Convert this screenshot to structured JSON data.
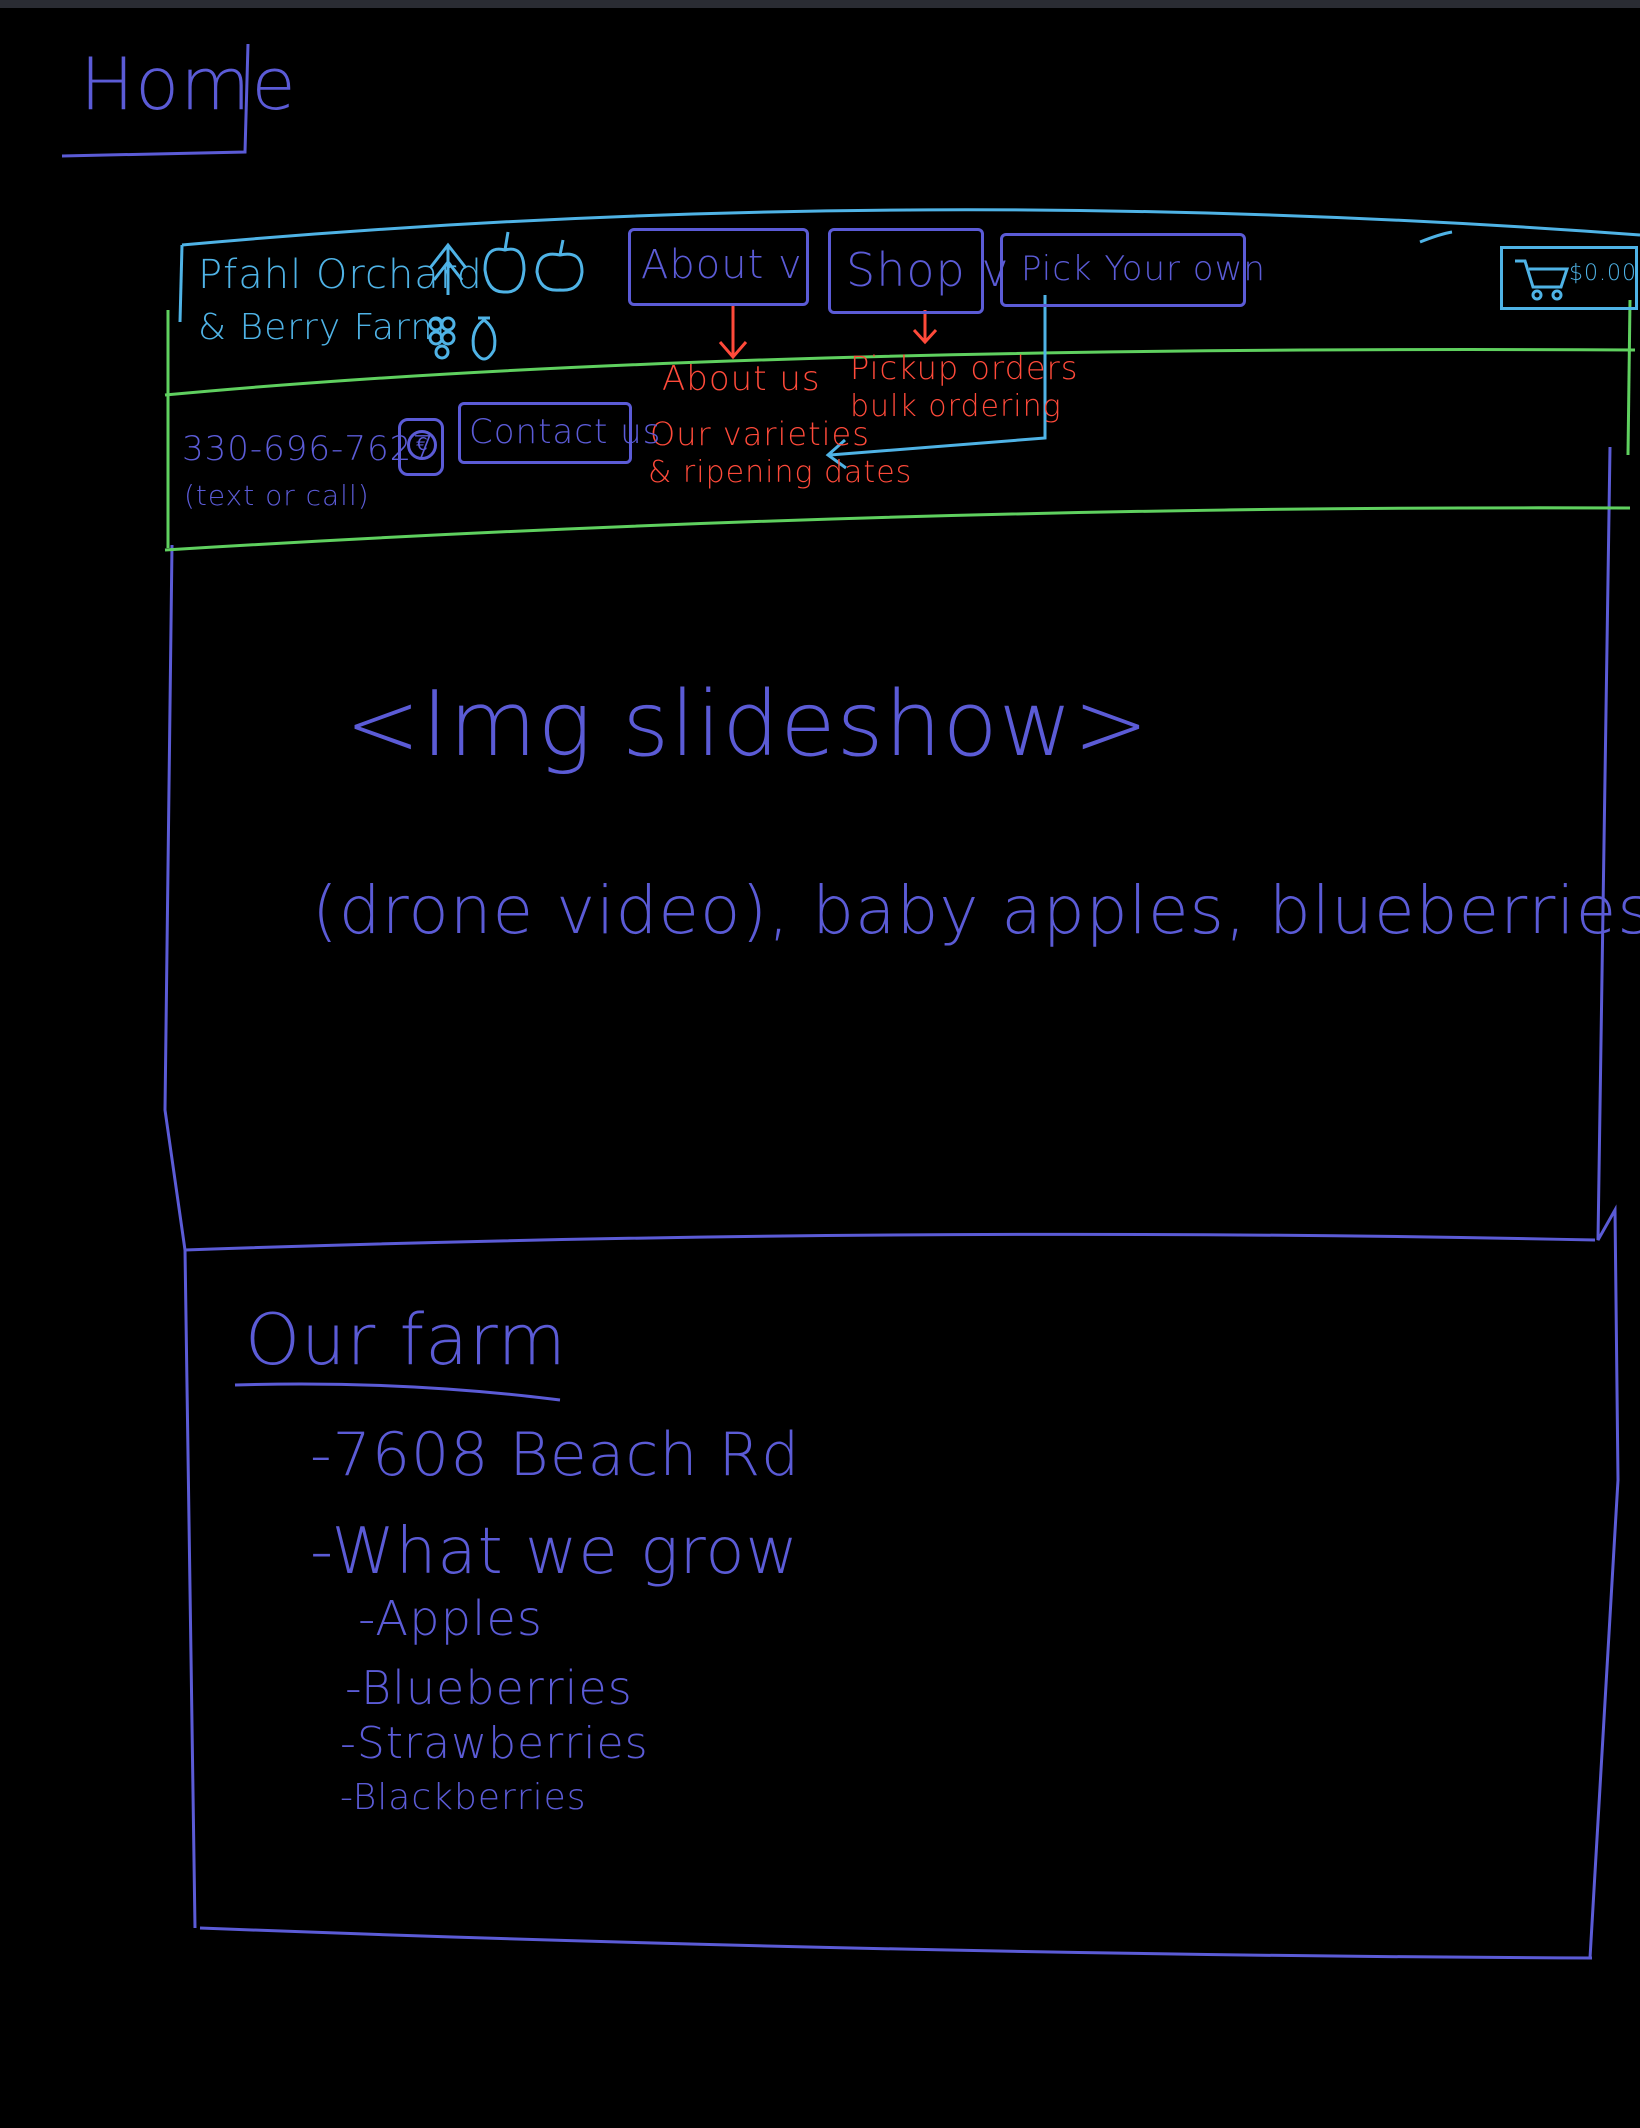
{
  "page_label": "Home",
  "header": {
    "brand_line1": "Pfahl Orchard",
    "brand_line2": "& Berry Farm",
    "nav": {
      "about": "About v",
      "shop": "Shop v",
      "pick": "Pick Your own"
    },
    "cart_amount": "$0.00",
    "about_dropdown": [
      "About us",
      "Our varieties",
      "& ripening dates"
    ],
    "shop_dropdown": [
      "Pickup orders",
      "bulk ordering"
    ],
    "phone": "330-696-7627",
    "phone_note": "(text or call)",
    "contact_label": "Contact us"
  },
  "hero": {
    "title": "<Img slideshow>",
    "caption": "(drone video), baby apples, blueberries"
  },
  "farm": {
    "heading": "Our farm",
    "address": "-7608 Beach Rd",
    "grow_label": "-What we grow",
    "crops": [
      "-Apples",
      "-Blueberries",
      "-Strawberries",
      "-Blackberries"
    ]
  },
  "colors": {
    "wireframe": "#5b5bd6",
    "header": "#4fb3e6",
    "nav_band": "#5fd05f",
    "dropdown": "#ff4a3a"
  }
}
